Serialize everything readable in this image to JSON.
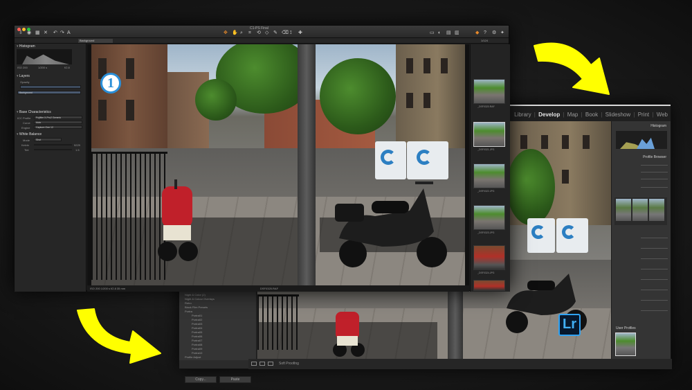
{
  "lightroom": {
    "modules": [
      "Library",
      "Develop",
      "Map",
      "Book",
      "Slideshow",
      "Print",
      "Web"
    ],
    "separator": "|",
    "panels": {
      "histogram": "Histogram",
      "profile_browser": "Profile Browser",
      "user_profiles": "User Profiles"
    },
    "presets": [
      "Night & Color (2)",
      "Night & Colour Overlays",
      "Retro",
      "Black Film Presets",
      "Portra",
      "Portra01",
      "Portra02",
      "Portra03",
      "Portra04",
      "Portra05",
      "Portra06",
      "Portra07",
      "Portra08",
      "Portra09",
      "Portra10",
      "Profile Adjust"
    ],
    "copy_label": "Copy...",
    "paste_label": "Paste",
    "soft_proofing": "Soft Proofing",
    "logo_text": "Lr",
    "colors": {
      "logo_bg": "#07182d",
      "logo_accent": "#2fa3f5"
    }
  },
  "capture_one": {
    "window_title": "C1-PS Final",
    "layer_tab": "Background",
    "counter": "1/124",
    "sections": {
      "histogram": "Histogram",
      "layers": "Layers",
      "base_characteristics": "Base Characteristics",
      "white_balance": "White Balance"
    },
    "histogram_readout": [
      "ISO 200",
      "1/200 s",
      "f/2.8"
    ],
    "layers": {
      "opacity_label": "Opacity",
      "background_item": "Background"
    },
    "base": {
      "icc_label": "ICC Profile",
      "icc_value": "Fujifilm X-Pro2 Generic",
      "curve_label": "Curve",
      "curve_value": "Auto",
      "engine_label": "Engine",
      "engine_value": "Capture One 12"
    },
    "white_balance": {
      "mode_label": "Mode",
      "mode_value": "Shot",
      "kelvin_label": "Kelvin",
      "kelvin_value": "5229",
      "tint_label": "Tint",
      "tint_value": "1.5"
    },
    "filmstrip": [
      "_DSF0320.RAF",
      "_DSF0321.JPG",
      "_DSF0322.JPG",
      "_DSF0323.JPG",
      "_DSF0324.JPG",
      "_DSF0325.JPG"
    ],
    "status_left": "ISO 200   1/200 s   f/2.8   35 mm",
    "status_center": "DSF0325.RAF",
    "badge_text": "1",
    "colors": {
      "badge_ring": "#2a8fd8"
    }
  },
  "arrows": {
    "color": "#ffff00",
    "icon": "curved-arrow-icon"
  }
}
